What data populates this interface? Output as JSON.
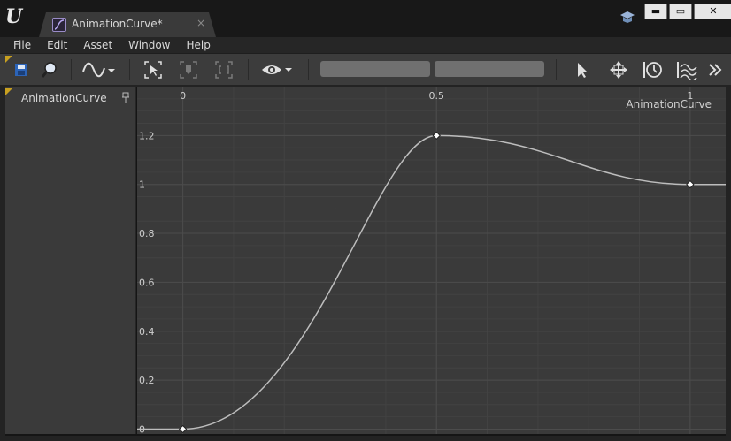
{
  "window": {
    "tab_title": "AnimationCurve*",
    "tab_close": "×",
    "buttons": {
      "minimize": "▬",
      "maximize": "▭",
      "close": "✕"
    }
  },
  "menu": [
    "File",
    "Edit",
    "Asset",
    "Window",
    "Help"
  ],
  "toolbar": {
    "icons": [
      "save-icon",
      "browse-icon",
      "curve-mode-icon",
      "select-all-icon",
      "key-icon",
      "frame-icon",
      "visibility-icon",
      "select-tool-icon",
      "move-tool-icon",
      "time-snap-icon",
      "value-snap-icon",
      "more-icon"
    ]
  },
  "curves_panel": {
    "items": [
      {
        "label": "AnimationCurve"
      }
    ]
  },
  "graph": {
    "curve_name": "AnimationCurve",
    "x_ticks": [
      "0",
      "0.5",
      "1"
    ],
    "y_ticks": [
      "0",
      "0.2",
      "0.4",
      "0.6",
      "0.8",
      "1",
      "1.2"
    ],
    "curve_color": "#bdbdbd",
    "key_color": "#ffffff"
  },
  "chart_data": {
    "type": "line",
    "x": [
      0,
      0.5,
      1
    ],
    "y": [
      0,
      1.2,
      1
    ],
    "xlim": [
      -0.09,
      1.07
    ],
    "ylim": [
      -0.02,
      1.4
    ],
    "grid": true
  }
}
